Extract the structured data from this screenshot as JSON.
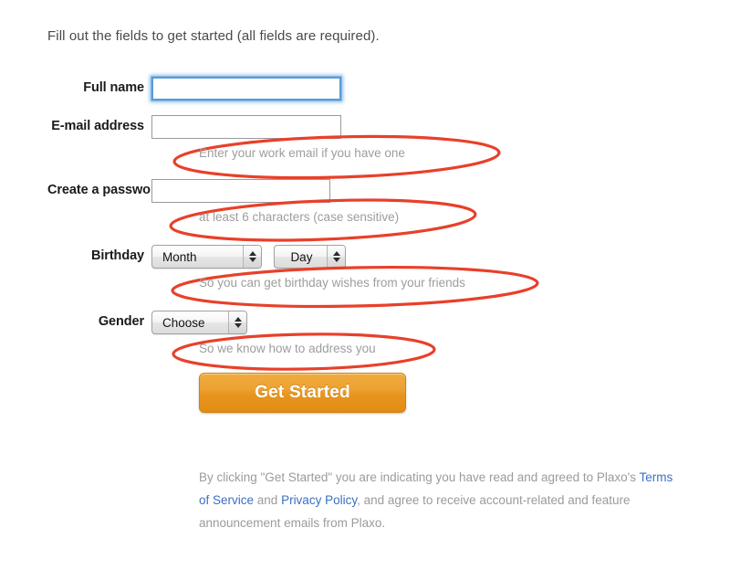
{
  "intro": "Fill out the fields to get started (all fields are required).",
  "fields": {
    "full_name": {
      "label": "Full name",
      "value": "",
      "placeholder": "",
      "focused": true
    },
    "email": {
      "label": "E-mail address",
      "value": "",
      "placeholder": "",
      "hint": "Enter your work email if you have one",
      "hint_annotated": true
    },
    "password": {
      "label": "Create a password",
      "value": "",
      "placeholder": "",
      "hint": "at least 6 characters (case sensitive)",
      "hint_annotated": true
    },
    "birthday": {
      "label": "Birthday",
      "month_select": "Month",
      "day_select": "Day",
      "hint": "So you can get birthday wishes from your friends",
      "hint_annotated": true
    },
    "gender": {
      "label": "Gender",
      "select": "Choose",
      "hint": "So we know how to address you",
      "hint_annotated": true
    }
  },
  "submit": {
    "label": "Get Started"
  },
  "legal": {
    "part1": "By clicking \"Get Started\" you are indicating you have read and agreed to Plaxo's ",
    "link_terms": "Terms of Service",
    "part2": " and ",
    "link_privacy": "Privacy Policy",
    "part3": ", and agree to receive account-related and feature announcement emails from Plaxo."
  },
  "colors": {
    "annotation_red": "#e8402a",
    "link_blue": "#3b6fc4",
    "button_orange": "#e8951f",
    "focus_blue": "#5b9bd5",
    "hint_gray": "#9d9d9d"
  },
  "icons": {
    "select_arrows": "up-down-arrows-icon",
    "annotation": "red-ellipse-annotation-icon"
  }
}
